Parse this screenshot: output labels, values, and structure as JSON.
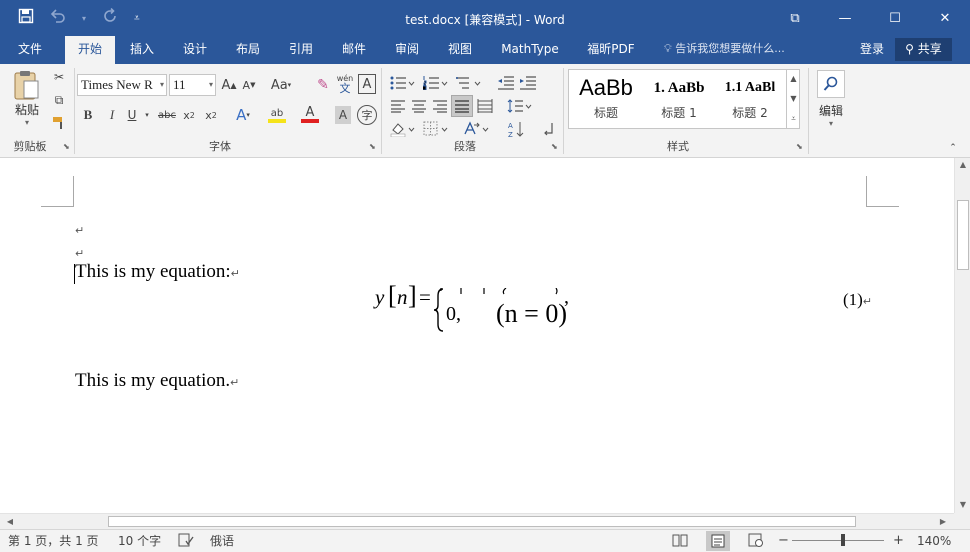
{
  "window": {
    "title": "test.docx [兼容模式] - Word",
    "quick_access": {
      "save_icon": "save-icon",
      "undo_icon": "undo-icon",
      "redo_icon": "redo-icon",
      "customize_icon": "customize-qat-icon"
    },
    "controls": {
      "ribbon_display": "⧉",
      "minimize": "—",
      "maximize": "☐",
      "close": "✕"
    }
  },
  "ribbon_tabs": {
    "items": [
      {
        "label": "文件"
      },
      {
        "label": "开始",
        "active": true
      },
      {
        "label": "插入"
      },
      {
        "label": "设计"
      },
      {
        "label": "布局"
      },
      {
        "label": "引用"
      },
      {
        "label": "邮件"
      },
      {
        "label": "审阅"
      },
      {
        "label": "视图"
      },
      {
        "label": "MathType"
      },
      {
        "label": "福昕PDF"
      }
    ],
    "tell_me": "告诉我您想要做什么...",
    "sign_in": "登录",
    "share": "共享"
  },
  "ribbon": {
    "clipboard": {
      "label": "剪贴板",
      "paste": "粘贴"
    },
    "font": {
      "label": "字体",
      "font_name": "Times New R",
      "font_size": "11",
      "grow": "A",
      "shrink": "A",
      "change_case": "Aa",
      "clear_format": "✎",
      "phonetic_top": "wén",
      "phonetic_bottom": "文",
      "char_border": "A",
      "bold": "B",
      "italic": "I",
      "underline": "U",
      "strike": "abc",
      "subscript": "x",
      "subscript_mark": "2",
      "superscript": "x",
      "superscript_mark": "2",
      "text_effects": "A",
      "highlight": "ab",
      "font_color": "A",
      "char_shading": "A",
      "enclose": "字"
    },
    "paragraph": {
      "label": "段落"
    },
    "styles": {
      "label": "样式",
      "items": [
        {
          "preview": "AaBb",
          "name": "标题"
        },
        {
          "preview": "1. AaBb",
          "name": "标题 1"
        },
        {
          "preview": "1.1 AaBl",
          "name": "标题 2"
        }
      ]
    },
    "editing": {
      "label": "编辑"
    },
    "colors": {
      "highlight": "#f5e31a",
      "font_color": "#e02020"
    }
  },
  "document": {
    "para_mark": "↵",
    "line1": "This is my equation:",
    "equation": {
      "lhs": "y",
      "index": "n",
      "equals": "=",
      "case_value": "0,",
      "case_condition": "(n = 0)",
      "comma": ","
    },
    "equation_number": "(1)",
    "line2": "This is my equation."
  },
  "status": {
    "page": "第 1 页，共 1 页",
    "word_count": "10 个字",
    "language": "俄语",
    "zoom": "140%",
    "zoom_minus": "−",
    "zoom_plus": "+"
  }
}
